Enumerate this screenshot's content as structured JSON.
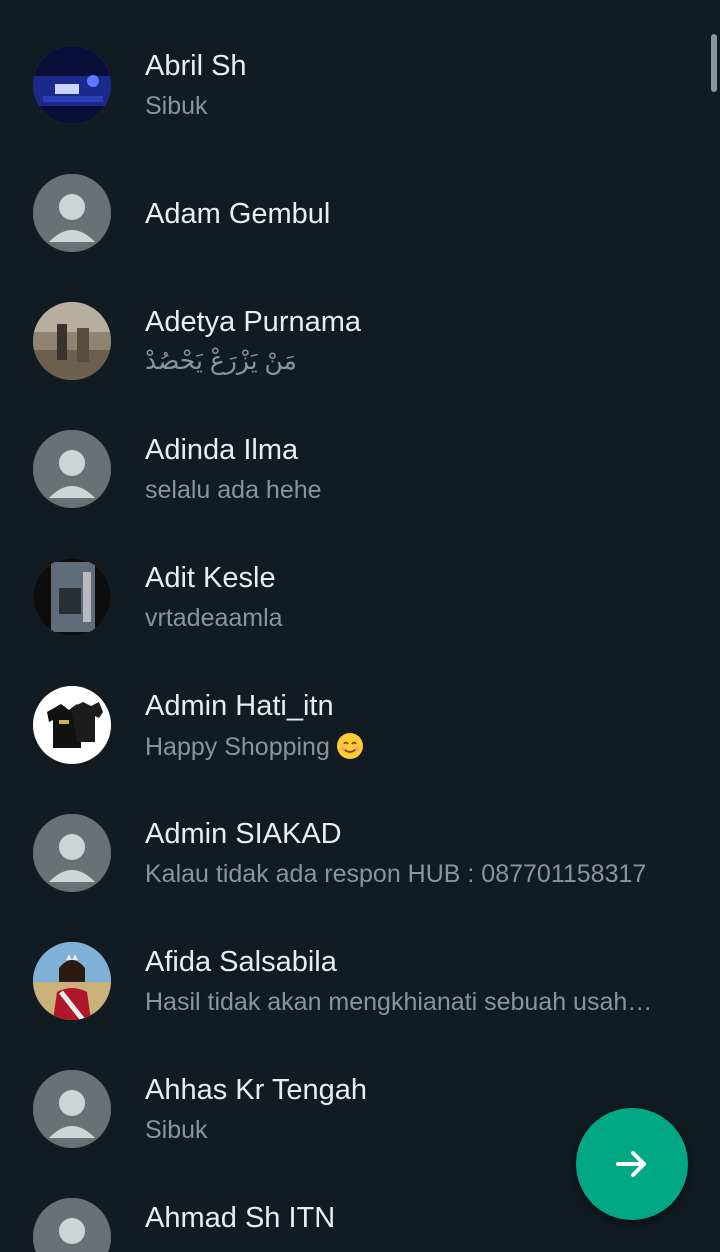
{
  "contacts": [
    {
      "name": "Abril Sh",
      "status": "Sibuk",
      "avatar": "photo-concert"
    },
    {
      "name": "Adam Gembul",
      "status": "",
      "avatar": "default"
    },
    {
      "name": "Adetya Purnama",
      "status": "مَنْ يَزْرَعْ يَحْصُدْ",
      "avatar": "photo-people"
    },
    {
      "name": "Adinda Ilma",
      "status": "selalu ada hehe",
      "avatar": "default"
    },
    {
      "name": "Adit Kesle",
      "status": "vrtadeaamla",
      "avatar": "photo-dark"
    },
    {
      "name": "Admin Hati_itn",
      "status": "Happy Shopping",
      "avatar": "photo-shirts",
      "status_emoji": "smiling-face"
    },
    {
      "name": "Admin SIAKAD",
      "status": "Kalau tidak ada respon HUB : 087701158317",
      "avatar": "default"
    },
    {
      "name": "Afida Salsabila",
      "status": "Hasil tidak akan mengkhianati sebuah usah…",
      "avatar": "photo-pageant"
    },
    {
      "name": "Ahhas Kr Tengah",
      "status": "Sibuk",
      "avatar": "default"
    },
    {
      "name": "Ahmad Sh ITN",
      "status": "",
      "avatar": "default"
    }
  ],
  "fab": {
    "icon": "arrow-right-icon"
  },
  "colors": {
    "background": "#121b22",
    "accent": "#00a884",
    "primary_text": "#e9edef",
    "secondary_text": "#8696a0"
  }
}
